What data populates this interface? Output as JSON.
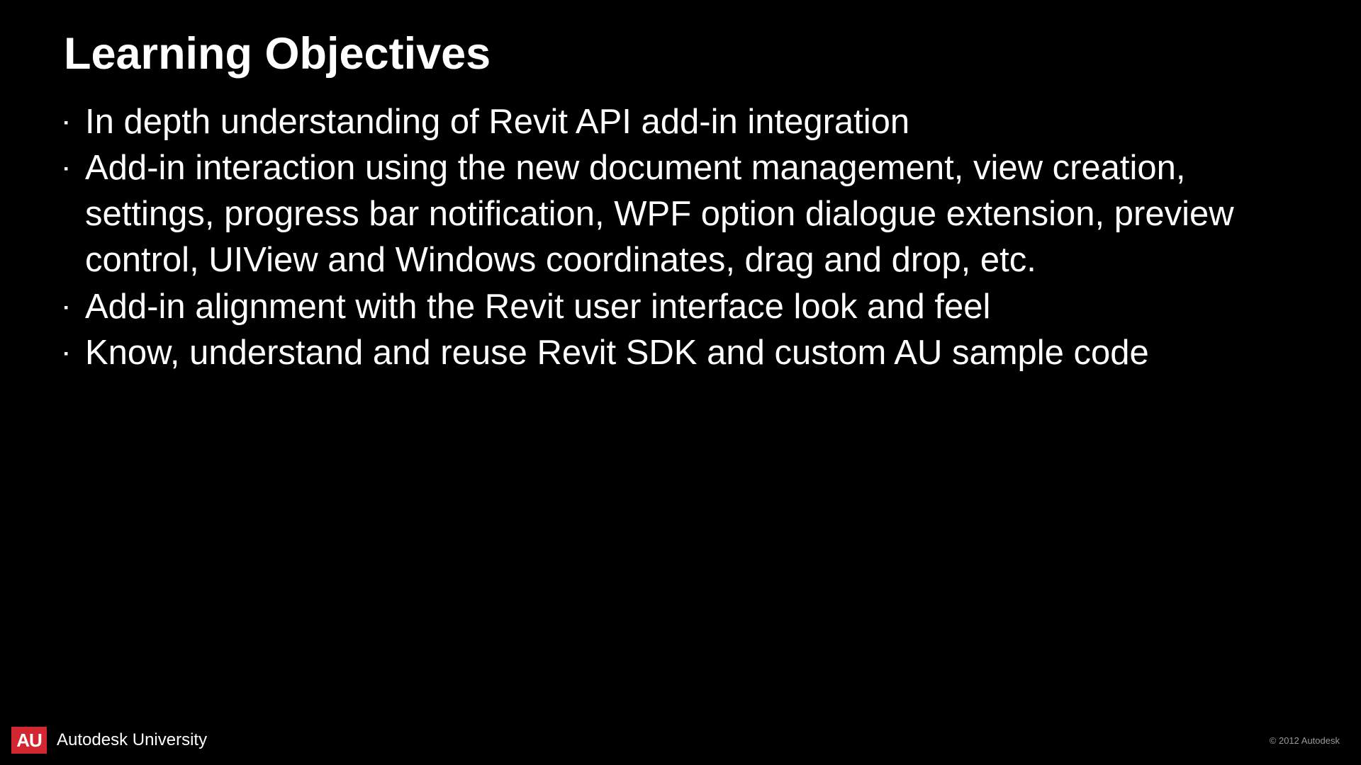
{
  "slide": {
    "title": "Learning Objectives",
    "bullets": [
      "In depth understanding of Revit API add-in integration",
      "Add-in interaction using the new document management, view creation, settings, progress bar notification, WPF option dialogue extension, preview control, UIView and Windows coordinates, drag and drop, etc.",
      "Add-in alignment with the Revit user interface look and feel",
      "Know, understand and reuse Revit SDK and custom AU sample code"
    ]
  },
  "footer": {
    "logo_text": "AU",
    "brand_text": "Autodesk University",
    "copyright": "© 2012 Autodesk"
  }
}
